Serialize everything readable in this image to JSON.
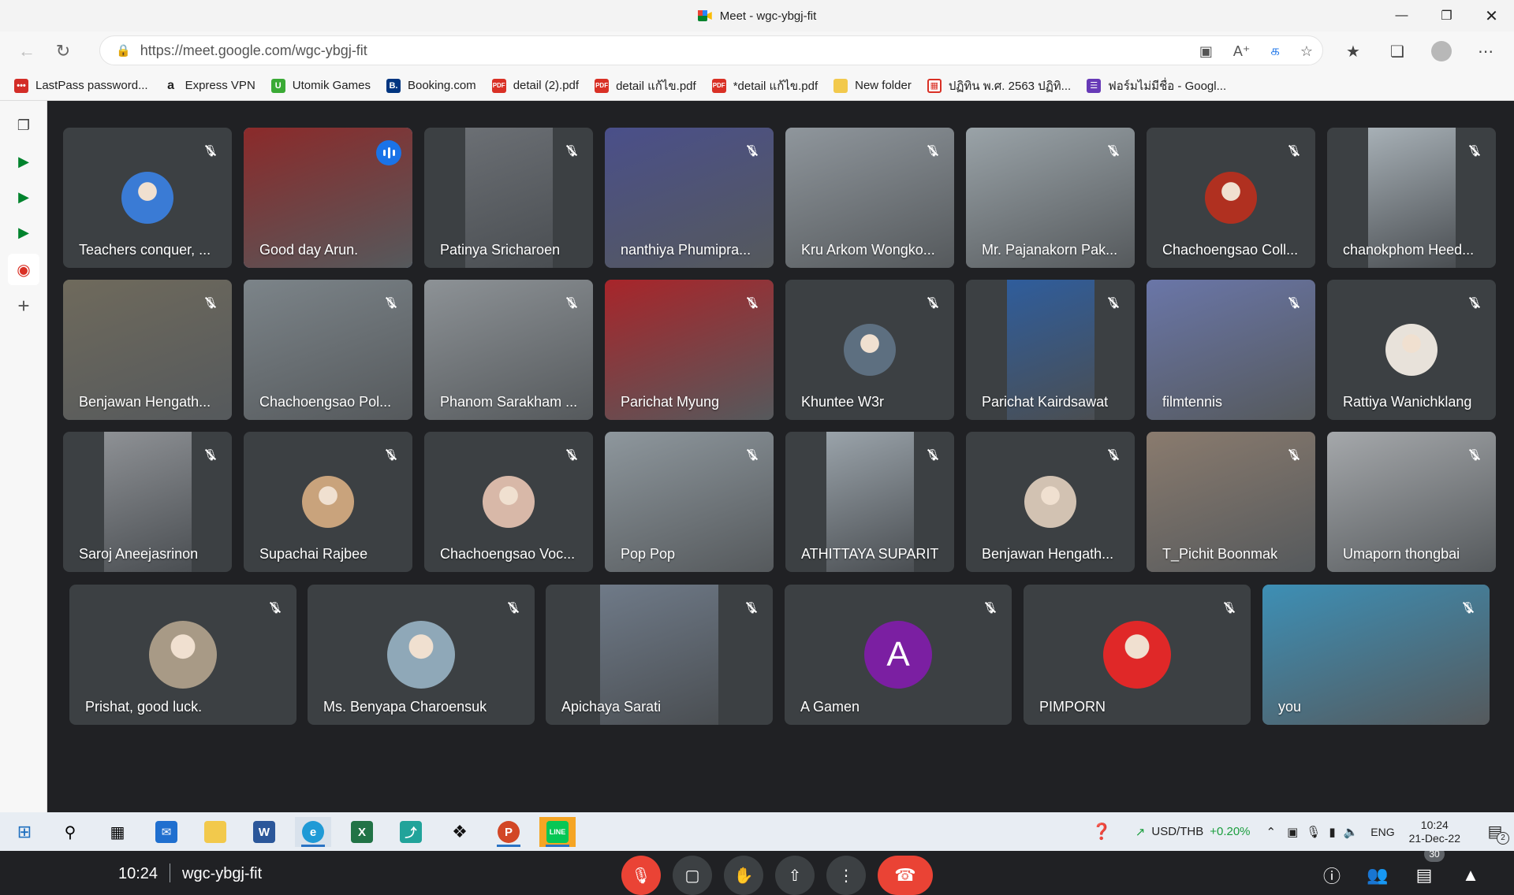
{
  "window": {
    "title": "Meet - wgc-ybgj-fit"
  },
  "browser": {
    "url": "https://meet.google.com/wgc-ybgj-fit",
    "bookmarks": [
      {
        "label": "LastPass password...",
        "icon": "lastpass-icon",
        "color": "#d32d27"
      },
      {
        "label": "Express VPN",
        "icon": "amazon-icon",
        "color": "#222222"
      },
      {
        "label": "Utomik Games",
        "icon": "utomik-icon",
        "color": "#3aaa35"
      },
      {
        "label": "Booking.com",
        "icon": "booking-icon",
        "color": "#003580"
      },
      {
        "label": "detail (2).pdf",
        "icon": "pdf-icon",
        "color": "#d93025"
      },
      {
        "label": "detail แก้ไข.pdf",
        "icon": "pdf-icon",
        "color": "#d93025"
      },
      {
        "label": "*detail แก้ไข.pdf",
        "icon": "pdf-icon",
        "color": "#d93025"
      },
      {
        "label": "New folder",
        "icon": "folder-icon",
        "color": "#f2c94c"
      },
      {
        "label": "ปฏิทิน พ.ศ. 2563 ปฏิทิ...",
        "icon": "calendar-icon",
        "color": "#d93025"
      },
      {
        "label": "ฟอร์มไม่มีชื่อ - Googl...",
        "icon": "forms-icon",
        "color": "#673ab7"
      }
    ]
  },
  "meeting": {
    "time": "10:24",
    "code": "wgc-ybgj-fit",
    "participant_count": "30",
    "participants": [
      {
        "name": "Teachers conquer, ...",
        "type": "avatar",
        "color": "#3a7bd5",
        "muted": true
      },
      {
        "name": "Good day Arun.",
        "type": "video",
        "color": "#8b2a2a",
        "speaking": true
      },
      {
        "name": "Patinya Sricharoen",
        "type": "video-narrow",
        "color": "#6b6f74",
        "muted": true
      },
      {
        "name": "nanthiya Phumipra...",
        "type": "video",
        "color": "#4a4f8a",
        "muted": true
      },
      {
        "name": "Kru Arkom Wongko...",
        "type": "video",
        "color": "#8f969c",
        "muted": true
      },
      {
        "name": "Mr. Pajanakorn Pak...",
        "type": "video",
        "color": "#9aa3a8",
        "muted": true
      },
      {
        "name": "Chachoengsao Coll...",
        "type": "avatar",
        "color": "#b03020",
        "muted": true
      },
      {
        "name": "chanokphom Heed...",
        "type": "video-narrow",
        "color": "#a7b0b6",
        "muted": true
      },
      {
        "name": "Benjawan Hengath...",
        "type": "video",
        "color": "#6f6a5c",
        "muted": true
      },
      {
        "name": "Chachoengsao Pol...",
        "type": "video",
        "color": "#7c8489",
        "muted": true
      },
      {
        "name": "Phanom Sarakham ...",
        "type": "video",
        "color": "#8d9296",
        "muted": true
      },
      {
        "name": "Parichat Myung",
        "type": "video",
        "color": "#a8252a",
        "muted": true
      },
      {
        "name": "Khuntee W3r",
        "type": "avatar",
        "color": "#5d6f80",
        "muted": true
      },
      {
        "name": "Parichat Kairdsawat",
        "type": "video-narrow",
        "color": "#2f5d9c",
        "muted": true
      },
      {
        "name": "filmtennis",
        "type": "video",
        "color": "#6a76a8",
        "muted": true
      },
      {
        "name": "Rattiya Wanichklang",
        "type": "avatar",
        "color": "#e8e2da",
        "muted": true
      },
      {
        "name": "Saroj Aneejasrinon",
        "type": "video-narrow",
        "color": "#8e9195",
        "muted": true
      },
      {
        "name": "Supachai Rajbee",
        "type": "avatar",
        "color": "#c9a37c",
        "muted": true
      },
      {
        "name": "Chachoengsao Voc...",
        "type": "avatar",
        "color": "#d8b8a8",
        "muted": true
      },
      {
        "name": "Pop Pop",
        "type": "video",
        "color": "#8e979d",
        "muted": true
      },
      {
        "name": "ATHITTAYA SUPARIT",
        "type": "video-narrow",
        "color": "#9aa3aa",
        "muted": true
      },
      {
        "name": "Benjawan Hengath...",
        "type": "avatar",
        "color": "#d2c2b2",
        "muted": true
      },
      {
        "name": "T_Pichit Boonmak",
        "type": "video",
        "color": "#8a7b6e",
        "muted": true
      },
      {
        "name": "Umaporn thongbai",
        "type": "video",
        "color": "#a5a8ab",
        "muted": true
      },
      {
        "name": "Prishat, good luck.",
        "type": "avatar-big",
        "color": "#a89a86",
        "muted": true
      },
      {
        "name": "Ms. Benyapa Charoensuk",
        "type": "avatar-big",
        "color": "#8fa8b8",
        "muted": true
      },
      {
        "name": "Apichaya Sarati",
        "type": "video-narrow",
        "color": "#6f7a88",
        "muted": true
      },
      {
        "name": "A Gamen",
        "type": "letter",
        "letter": "A",
        "color": "#7b1fa2",
        "muted": true
      },
      {
        "name": "PIMPORN",
        "type": "avatar-big",
        "color": "#e02828",
        "muted": true
      },
      {
        "name": "you",
        "type": "video",
        "color": "#3d8fb5",
        "muted": true
      }
    ]
  },
  "taskbar": {
    "currency_pair": "USD/THB",
    "currency_change": "+0.20%",
    "language": "ENG",
    "time": "10:24",
    "date": "21-Dec-22",
    "notification_count": "2"
  }
}
